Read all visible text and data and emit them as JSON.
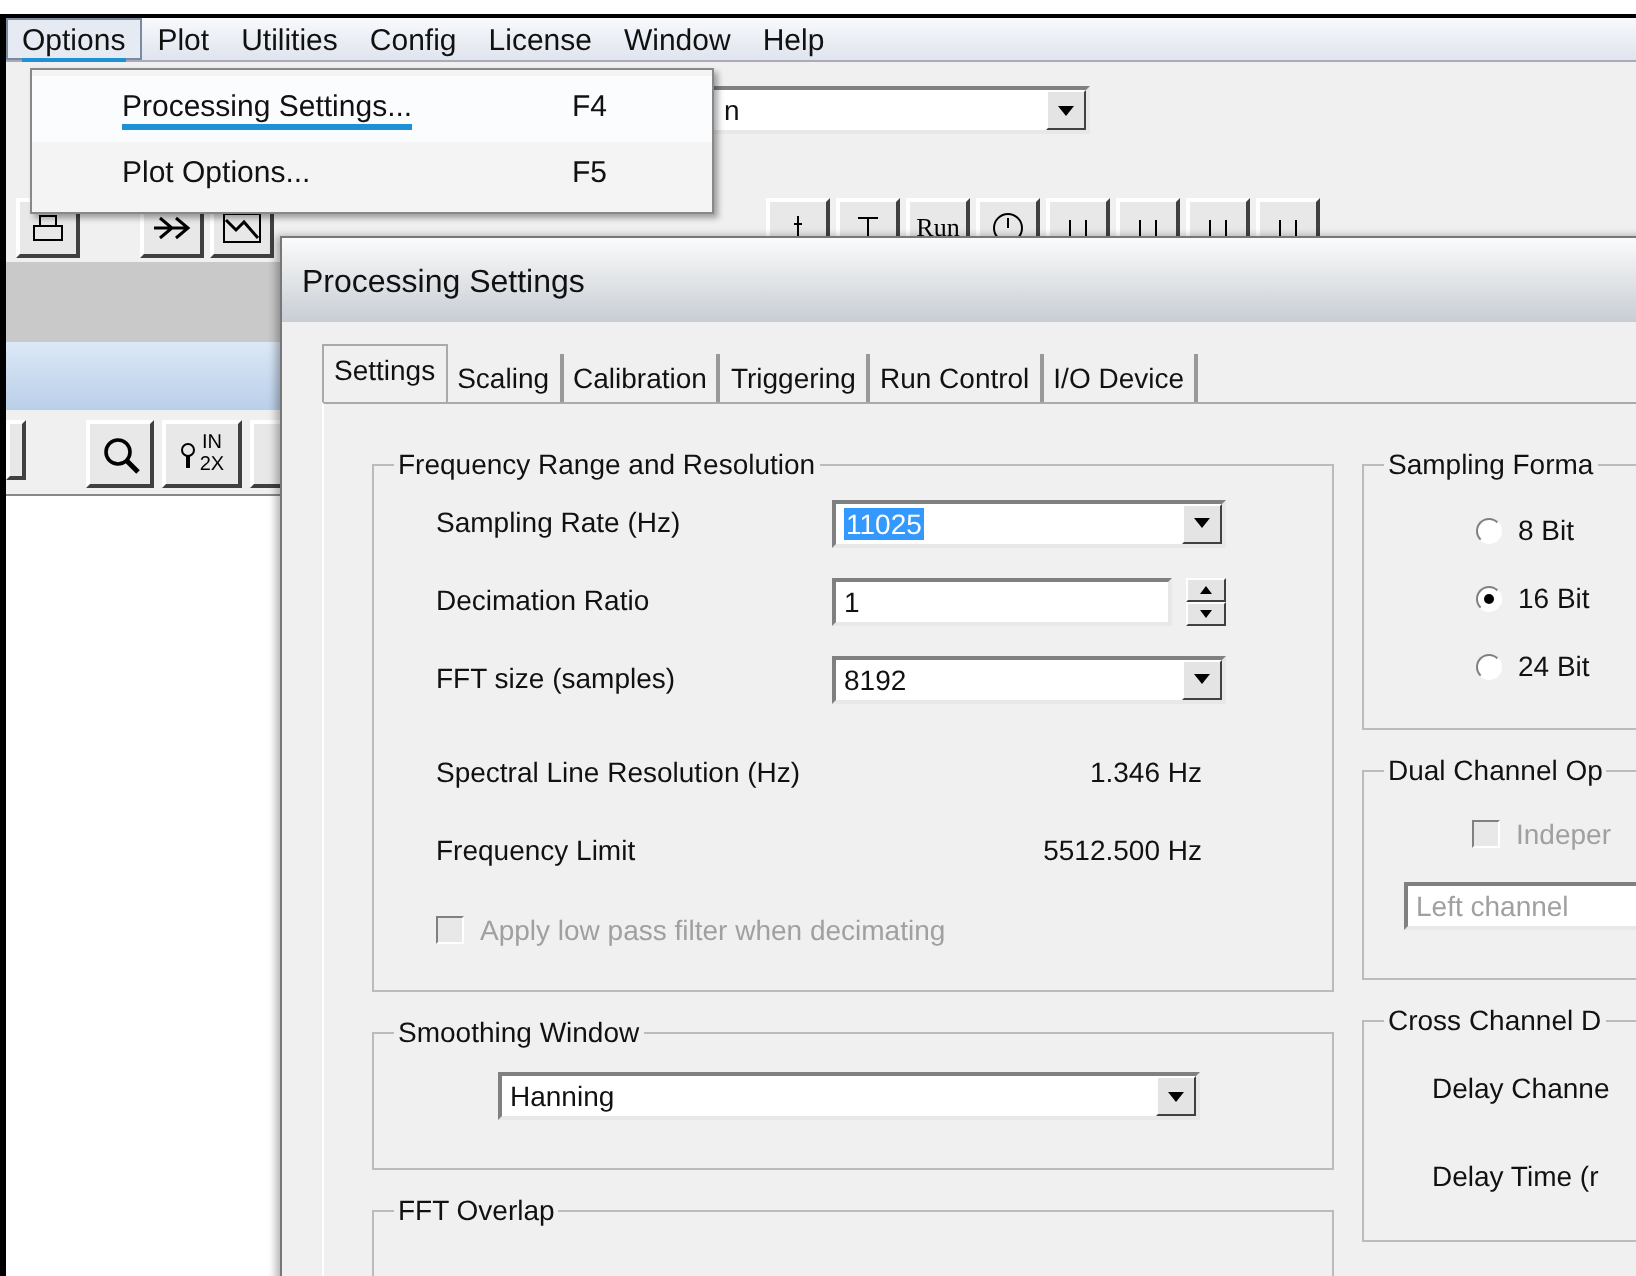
{
  "menu_bar": [
    {
      "label": "Options",
      "selected": true
    },
    {
      "label": "Plot",
      "selected": false
    },
    {
      "label": "Utilities",
      "selected": false
    },
    {
      "label": "Config",
      "selected": false
    },
    {
      "label": "License",
      "selected": false
    },
    {
      "label": "Window",
      "selected": false
    },
    {
      "label": "Help",
      "selected": false
    }
  ],
  "options_menu": [
    {
      "label": "Processing Settings...",
      "shortcut": "F4",
      "selected": true
    },
    {
      "label": "Plot Options...",
      "shortcut": "F5",
      "selected": false
    }
  ],
  "toolbar_combo": {
    "value": "n"
  },
  "toolbar_run_button": {
    "label": "Run"
  },
  "zoom_button": {
    "lines": [
      "IN",
      "2X"
    ]
  },
  "dialog": {
    "title": "Processing Settings",
    "tabs": [
      {
        "label": "Settings",
        "selected": true
      },
      {
        "label": "Scaling",
        "selected": false
      },
      {
        "label": "Calibration",
        "selected": false
      },
      {
        "label": "Triggering",
        "selected": false
      },
      {
        "label": "Run Control",
        "selected": false
      },
      {
        "label": "I/O Device",
        "selected": false
      }
    ],
    "frequency_group": {
      "title": "Frequency Range and Resolution",
      "sampling_rate": {
        "label": "Sampling Rate (Hz)",
        "value": "11025",
        "text_selected": true
      },
      "decimation_ratio": {
        "label": "Decimation Ratio",
        "value": "1"
      },
      "fft_size": {
        "label": "FFT size (samples)",
        "value": "8192",
        "text_selected": false
      },
      "readouts": [
        {
          "label": "Spectral Line Resolution (Hz)",
          "value": "1.346 Hz"
        },
        {
          "label": "Frequency Limit",
          "value": "5512.500 Hz"
        }
      ],
      "low_pass": {
        "label": "Apply low pass filter when decimating",
        "checked": false,
        "disabled": true
      }
    },
    "smoothing_group": {
      "title": "Smoothing Window",
      "value": "Hanning"
    },
    "overlap_group": {
      "title": "FFT Overlap"
    },
    "sampling_format_group": {
      "title": "Sampling Forma",
      "options": [
        {
          "label": "8 Bit",
          "selected": false
        },
        {
          "label": "16 Bit",
          "selected": true
        },
        {
          "label": "24 Bit",
          "selected": false
        }
      ]
    },
    "dual_channel_group": {
      "title": "Dual Channel Op",
      "independent": {
        "label": "Indeper",
        "checked": false,
        "disabled": true
      },
      "channel": {
        "value": "Left channel",
        "disabled": true
      }
    },
    "cross_channel_group": {
      "title": "Cross Channel D",
      "rows": [
        "Delay Channe",
        "Delay Time (r"
      ]
    }
  }
}
